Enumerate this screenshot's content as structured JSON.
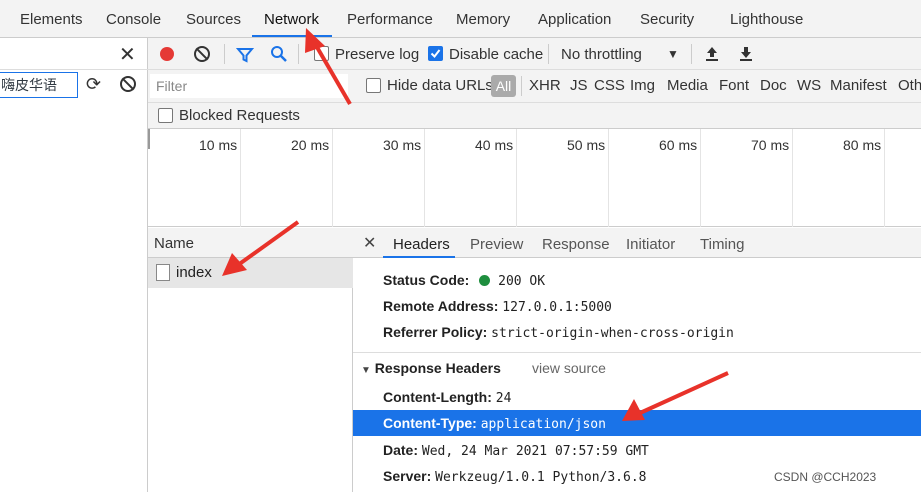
{
  "top_tabs": [
    "Elements",
    "Console",
    "Sources",
    "Network",
    "Performance",
    "Memory",
    "Application",
    "Security",
    "Lighthouse"
  ],
  "left": {
    "input_value": "嗨皮华语"
  },
  "toolbar": {
    "preserve_log": "Preserve log",
    "disable_cache": "Disable cache",
    "throttling": "No throttling",
    "filter_placeholder": "Filter",
    "hide_data_urls": "Hide data URLs",
    "types": [
      "All",
      "XHR",
      "JS",
      "CSS",
      "Img",
      "Media",
      "Font",
      "Doc",
      "WS",
      "Manifest",
      "Oth"
    ],
    "blocked_requests": "Blocked Requests"
  },
  "timeline": {
    "ticks": [
      "10 ms",
      "20 ms",
      "30 ms",
      "40 ms",
      "50 ms",
      "60 ms",
      "70 ms",
      "80 ms"
    ]
  },
  "request_list": {
    "header": "Name",
    "rows": [
      "index"
    ]
  },
  "detail": {
    "tabs": [
      "Headers",
      "Preview",
      "Response",
      "Initiator",
      "Timing"
    ],
    "general": [
      {
        "k": "Status Code:",
        "v": "200 OK"
      },
      {
        "k": "Remote Address:",
        "v": "127.0.0.1:5000"
      },
      {
        "k": "Referrer Policy:",
        "v": "strict-origin-when-cross-origin"
      }
    ],
    "response_headers_title": "Response Headers",
    "view_source": "view source",
    "response_headers": [
      {
        "k": "Content-Length:",
        "v": "24"
      },
      {
        "k": "Content-Type:",
        "v": "application/json"
      },
      {
        "k": "Date:",
        "v": "Wed, 24 Mar 2021 07:57:59 GMT"
      },
      {
        "k": "Server:",
        "v": "Werkzeug/1.0.1 Python/3.6.8"
      }
    ]
  },
  "colors": {
    "accent": "#1a73e8",
    "record": "#e53935",
    "status_ok": "#1e8e3e",
    "arrow": "#e8322a"
  },
  "watermark": "CSDN @CCH2023"
}
